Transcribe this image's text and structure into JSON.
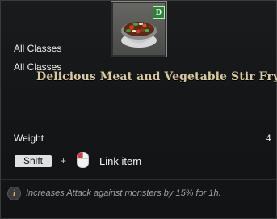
{
  "item": {
    "name": "Delicious Meat and Vegetable Stir Fry",
    "grade_badge": "D",
    "icon": "stir-fry-bowl-icon",
    "classes": [
      "All Classes",
      "All Classes"
    ]
  },
  "stats": {
    "weight_label": "Weight",
    "weight_value": "4"
  },
  "action": {
    "key": "Shift",
    "plus": "+",
    "mouse_icon": "mouse-left-click-icon",
    "label": "Link item"
  },
  "effect": {
    "icon": "info-icon",
    "icon_glyph": "i",
    "text": "Increases Attack against monsters by 15% for 1h."
  },
  "colors": {
    "item_name": "#d8c9a2",
    "grade_badge": "#2f7f3d",
    "effect_text": "#9ea0a3"
  }
}
